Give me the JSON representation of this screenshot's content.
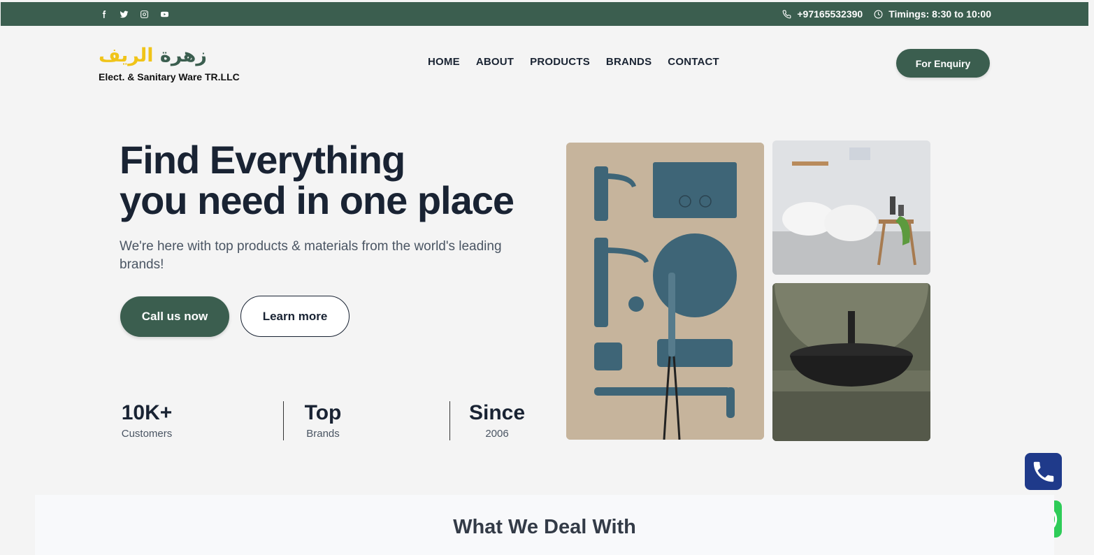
{
  "topbar": {
    "social_icons": [
      "facebook-icon",
      "twitter-icon",
      "instagram-icon",
      "youtube-icon"
    ],
    "phone": "+97165532390",
    "timings": "Timings: 8:30 to 10:00",
    "bg_color": "#3b5e4f"
  },
  "logo": {
    "arabic_part1": "زهرة",
    "arabic_part2": "الريف",
    "subtitle": "Elect. & Sanitary Ware TR.LLC"
  },
  "nav": {
    "items": [
      "HOME",
      "ABOUT",
      "PRODUCTS",
      "BRANDS",
      "CONTACT"
    ]
  },
  "header": {
    "enquiry_label": "For Enquiry"
  },
  "hero": {
    "title_line1": "Find Everything",
    "title_line2": "you need in one place",
    "subtitle": "We're here with top products & materials from the world's leading brands!",
    "primary_button": "Call us now",
    "secondary_button": "Learn more"
  },
  "stats": [
    {
      "value": "10K+",
      "label": "Customers"
    },
    {
      "value": "Top",
      "label": "Brands"
    },
    {
      "value": "Since",
      "label": "2006"
    }
  ],
  "section": {
    "title": "What We Deal With"
  },
  "colors": {
    "primary": "#3b5e4f",
    "accent": "#f0c419",
    "text": "#192333",
    "phone_button": "#1f3a8a",
    "whatsapp": "#2ecc58"
  }
}
